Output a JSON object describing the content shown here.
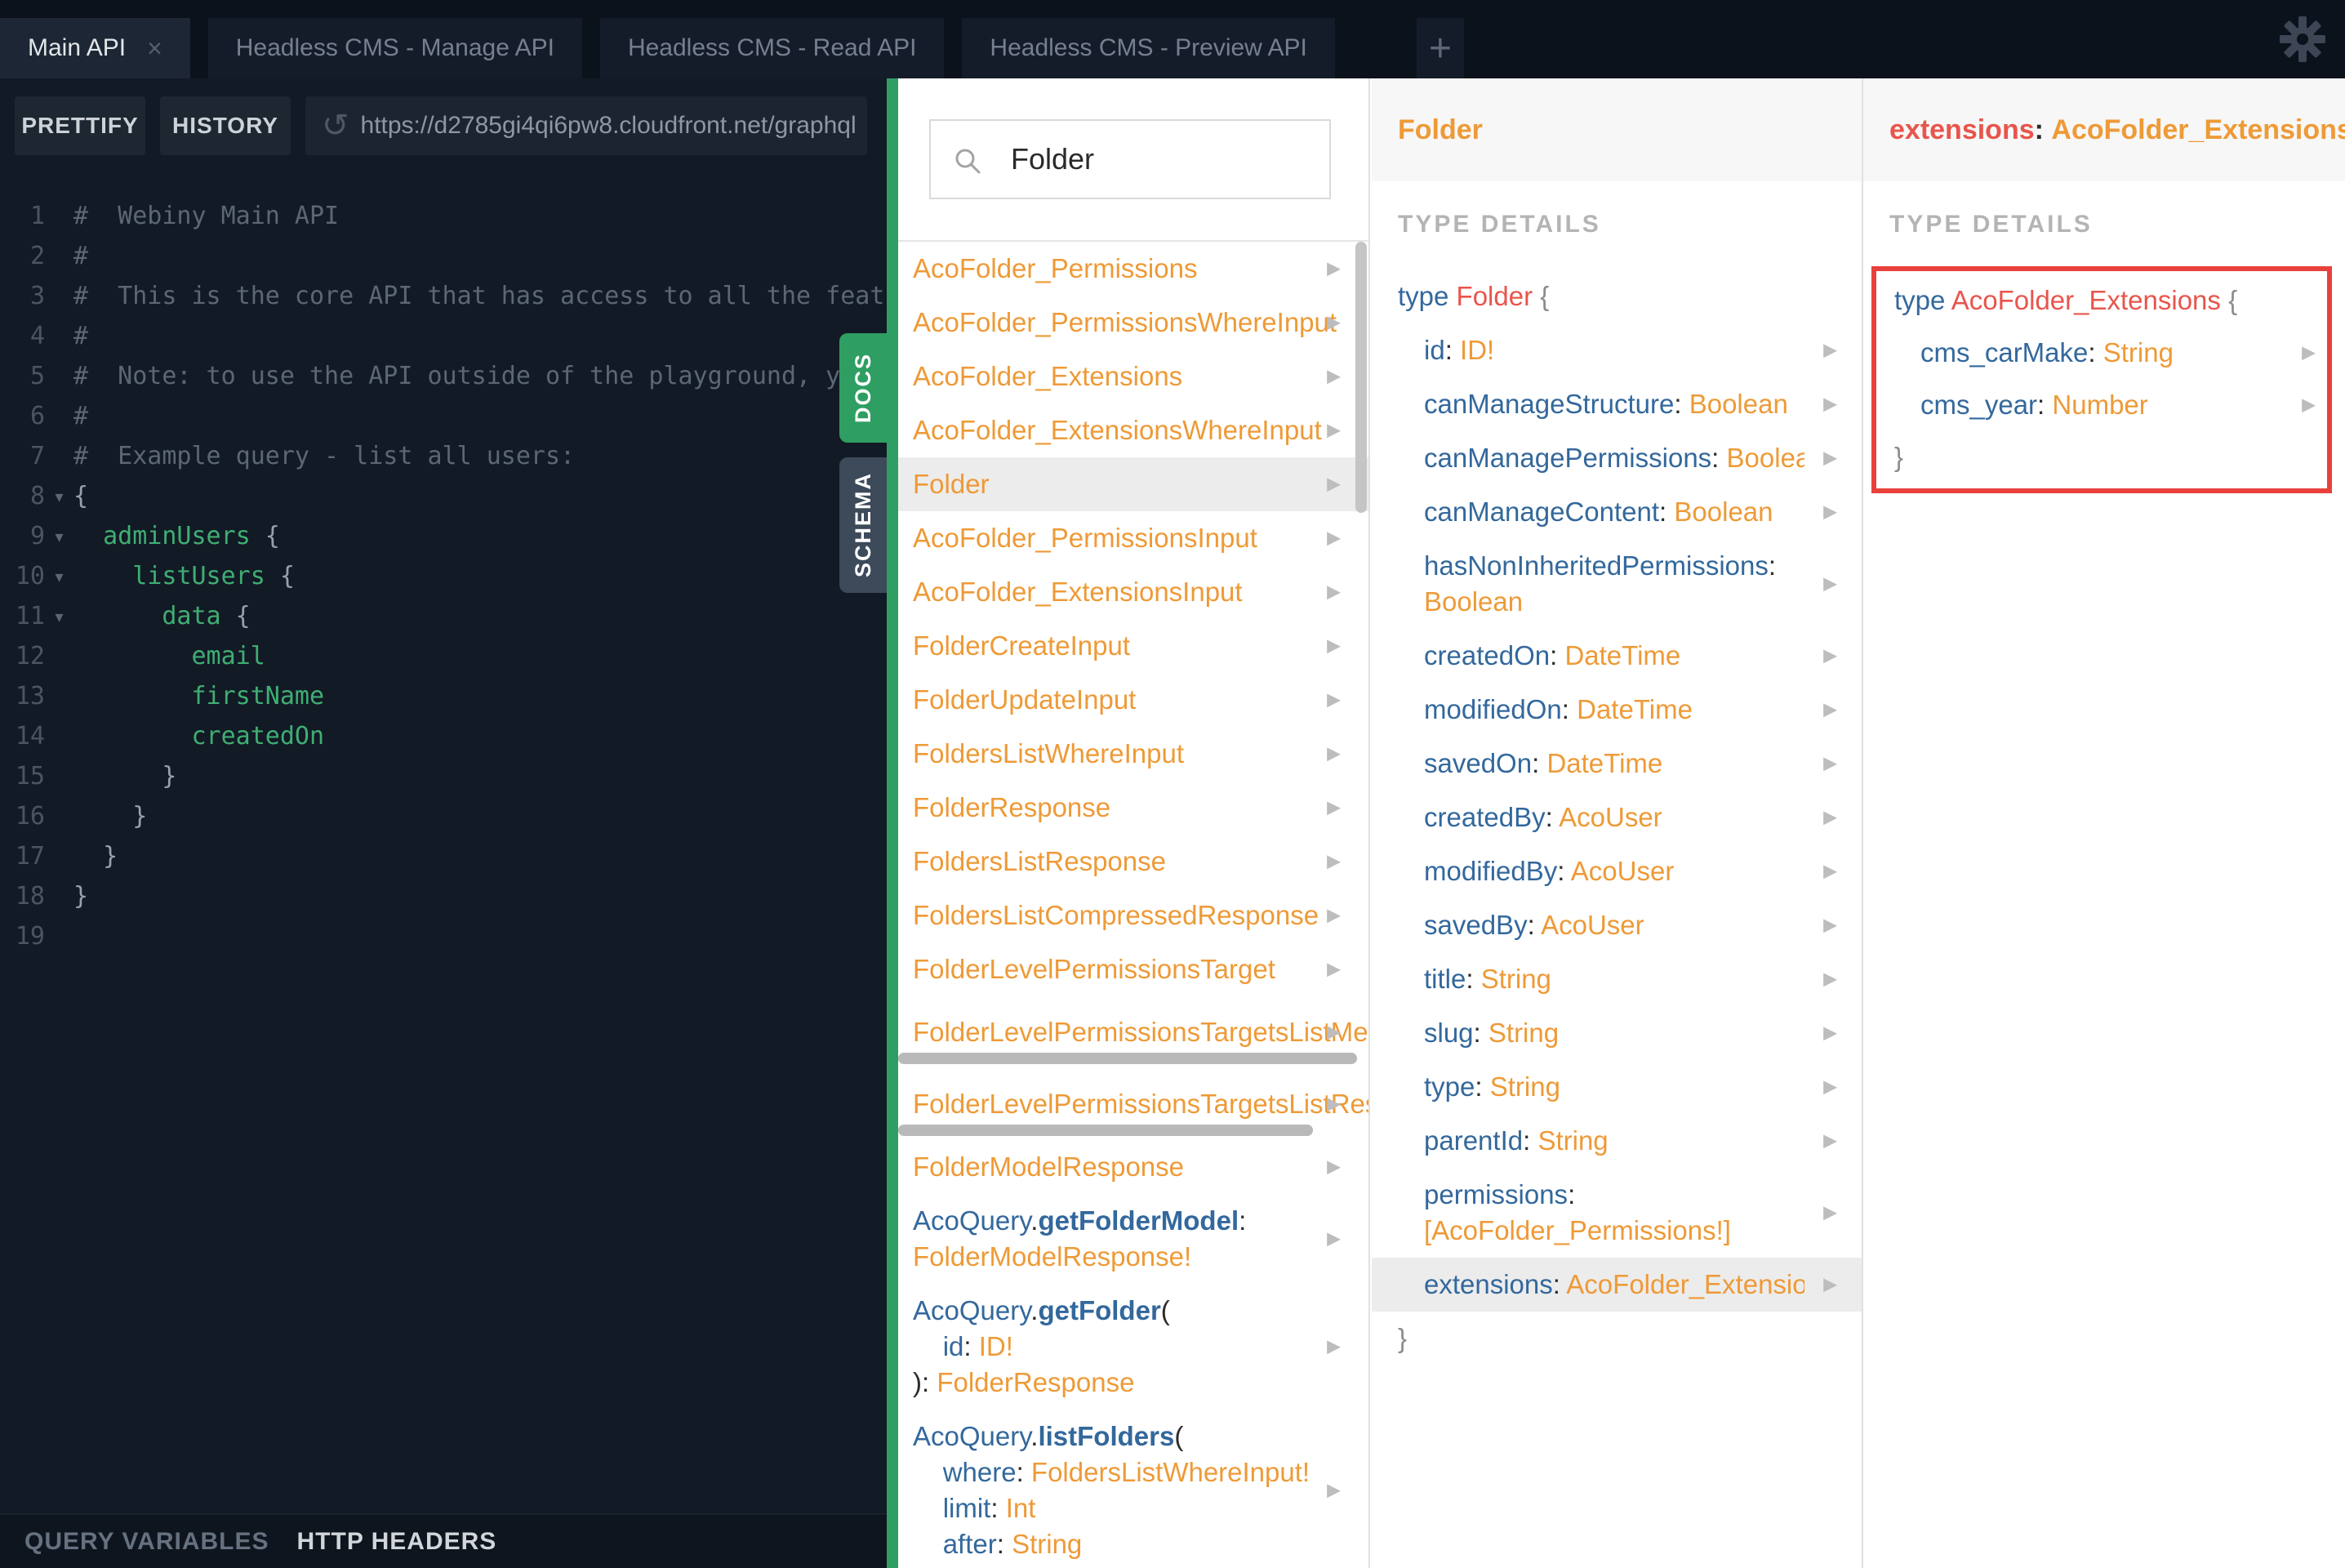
{
  "colors": {
    "accent_green": "#2f9e62",
    "type_orange": "#ee9a37",
    "field_blue": "#33689c",
    "selected_red": "#e8554c",
    "annotation_red": "#e8413c",
    "dark_bg": "#0c121c",
    "editor_bg": "#121a25"
  },
  "icons": {
    "close": "×",
    "plus": "+",
    "gear": "gear-icon",
    "search": "magnifier-icon",
    "reload": "↺",
    "row_arrow": "▶",
    "fold_arrow": "▾"
  },
  "tabs": {
    "items": [
      {
        "label": "Main API",
        "active": true,
        "closable": true
      },
      {
        "label": "Headless CMS - Manage API",
        "active": false,
        "closable": false
      },
      {
        "label": "Headless CMS - Read API",
        "active": false,
        "closable": false
      },
      {
        "label": "Headless CMS - Preview API",
        "active": false,
        "closable": false
      }
    ],
    "add_label": "+"
  },
  "toolbar": {
    "prettify": "PRETTIFY",
    "history": "HISTORY",
    "url": "https://d2785gi4qi6pw8.cloudfront.net/graphql"
  },
  "side_tabs": {
    "docs": "DOCS",
    "schema": "SCHEMA"
  },
  "bottom_bar": {
    "query_variables": "QUERY VARIABLES",
    "http_headers": "HTTP HEADERS"
  },
  "editor": {
    "lines": [
      {
        "num": 1,
        "fold": false,
        "segments": [
          {
            "c": "c",
            "v": "#  Webiny Main API"
          }
        ]
      },
      {
        "num": 2,
        "fold": false,
        "segments": [
          {
            "c": "c",
            "v": "#"
          }
        ]
      },
      {
        "num": 3,
        "fold": false,
        "segments": [
          {
            "c": "c",
            "v": "#  This is the core API that has access to all the features"
          }
        ]
      },
      {
        "num": 4,
        "fold": false,
        "segments": [
          {
            "c": "c",
            "v": "#"
          }
        ]
      },
      {
        "num": 5,
        "fold": false,
        "segments": [
          {
            "c": "c",
            "v": "#  Note: to use the API outside of the playground, you must"
          }
        ]
      },
      {
        "num": 6,
        "fold": false,
        "segments": [
          {
            "c": "c",
            "v": "#"
          }
        ]
      },
      {
        "num": 7,
        "fold": false,
        "segments": [
          {
            "c": "c",
            "v": "#  Example query - list all users:"
          }
        ]
      },
      {
        "num": 8,
        "fold": true,
        "segments": [
          {
            "c": "g",
            "v": "{"
          }
        ]
      },
      {
        "num": 9,
        "fold": true,
        "segments": [
          {
            "c": "pl",
            "v": "  "
          },
          {
            "c": "f",
            "v": "adminUsers"
          },
          {
            "c": "g",
            "v": " {"
          }
        ]
      },
      {
        "num": 10,
        "fold": true,
        "segments": [
          {
            "c": "pl",
            "v": "    "
          },
          {
            "c": "f",
            "v": "listUsers"
          },
          {
            "c": "g",
            "v": " {"
          }
        ]
      },
      {
        "num": 11,
        "fold": true,
        "segments": [
          {
            "c": "pl",
            "v": "      "
          },
          {
            "c": "f",
            "v": "data"
          },
          {
            "c": "g",
            "v": " {"
          }
        ]
      },
      {
        "num": 12,
        "fold": false,
        "segments": [
          {
            "c": "pl",
            "v": "        "
          },
          {
            "c": "f",
            "v": "email"
          }
        ]
      },
      {
        "num": 13,
        "fold": false,
        "segments": [
          {
            "c": "pl",
            "v": "        "
          },
          {
            "c": "f",
            "v": "firstName"
          }
        ]
      },
      {
        "num": 14,
        "fold": false,
        "segments": [
          {
            "c": "pl",
            "v": "        "
          },
          {
            "c": "f",
            "v": "createdOn"
          }
        ]
      },
      {
        "num": 15,
        "fold": false,
        "segments": [
          {
            "c": "g",
            "v": "      }"
          }
        ]
      },
      {
        "num": 16,
        "fold": false,
        "segments": [
          {
            "c": "g",
            "v": "    }"
          }
        ]
      },
      {
        "num": 17,
        "fold": false,
        "segments": [
          {
            "c": "g",
            "v": "  }"
          }
        ]
      },
      {
        "num": 18,
        "fold": false,
        "segments": [
          {
            "c": "g",
            "v": "}"
          }
        ]
      },
      {
        "num": 19,
        "fold": false,
        "segments": []
      }
    ]
  },
  "docs": {
    "search_value": "Folder",
    "items": [
      {
        "lines": [
          [
            {
              "c": "o",
              "v": "AcoFolder_Permissions"
            }
          ]
        ],
        "arrow": true
      },
      {
        "lines": [
          [
            {
              "c": "o",
              "v": "AcoFolder_PermissionsWhereInput"
            }
          ]
        ],
        "arrow": true
      },
      {
        "lines": [
          [
            {
              "c": "o",
              "v": "AcoFolder_Extensions"
            }
          ]
        ],
        "arrow": true
      },
      {
        "lines": [
          [
            {
              "c": "o",
              "v": "AcoFolder_ExtensionsWhereInput"
            }
          ]
        ],
        "arrow": true
      },
      {
        "lines": [
          [
            {
              "c": "o",
              "v": "Folder"
            }
          ]
        ],
        "arrow": true,
        "highlight": true
      },
      {
        "lines": [
          [
            {
              "c": "o",
              "v": "AcoFolder_PermissionsInput"
            }
          ]
        ],
        "arrow": true
      },
      {
        "lines": [
          [
            {
              "c": "o",
              "v": "AcoFolder_ExtensionsInput"
            }
          ]
        ],
        "arrow": true
      },
      {
        "lines": [
          [
            {
              "c": "o",
              "v": "FolderCreateInput"
            }
          ]
        ],
        "arrow": true
      },
      {
        "lines": [
          [
            {
              "c": "o",
              "v": "FolderUpdateInput"
            }
          ]
        ],
        "arrow": true
      },
      {
        "lines": [
          [
            {
              "c": "o",
              "v": "FoldersListWhereInput"
            }
          ]
        ],
        "arrow": true
      },
      {
        "lines": [
          [
            {
              "c": "o",
              "v": "FolderResponse"
            }
          ]
        ],
        "arrow": true
      },
      {
        "lines": [
          [
            {
              "c": "o",
              "v": "FoldersListResponse"
            }
          ]
        ],
        "arrow": true
      },
      {
        "lines": [
          [
            {
              "c": "o",
              "v": "FoldersListCompressedResponse"
            }
          ]
        ],
        "arrow": true
      },
      {
        "lines": [
          [
            {
              "c": "o",
              "v": "FolderLevelPermissionsTarget"
            }
          ]
        ],
        "arrow": true
      },
      {
        "lines": [
          [
            {
              "c": "o",
              "v": "FolderLevelPermissionsTargetsListMeta"
            }
          ]
        ],
        "arrow": true,
        "hbar_width": 562
      },
      {
        "lines": [
          [
            {
              "c": "o",
              "v": "FolderLevelPermissionsTargetsListResponse"
            }
          ]
        ],
        "arrow": true,
        "hbar_width": 508
      },
      {
        "lines": [
          [
            {
              "c": "o",
              "v": "FolderModelResponse"
            }
          ]
        ],
        "arrow": true
      },
      {
        "lines": [
          [
            {
              "c": "b",
              "v": "AcoQuery"
            },
            {
              "c": "p",
              "v": "."
            },
            {
              "c": "bb",
              "v": "getFolderModel"
            },
            {
              "c": "p",
              "v": ":"
            }
          ],
          [
            {
              "c": "o",
              "v": "FolderModelResponse!"
            }
          ]
        ],
        "arrow": true
      },
      {
        "lines": [
          [
            {
              "c": "b",
              "v": "AcoQuery"
            },
            {
              "c": "p",
              "v": "."
            },
            {
              "c": "bb",
              "v": "getFolder"
            },
            {
              "c": "p",
              "v": "("
            }
          ],
          [
            {
              "c": "pl",
              "v": "    "
            },
            {
              "c": "b",
              "v": "id"
            },
            {
              "c": "p",
              "v": ": "
            },
            {
              "c": "o",
              "v": "ID!"
            }
          ],
          [
            {
              "c": "p",
              "v": "): "
            },
            {
              "c": "o",
              "v": "FolderResponse"
            }
          ]
        ],
        "arrow": true
      },
      {
        "lines": [
          [
            {
              "c": "b",
              "v": "AcoQuery"
            },
            {
              "c": "p",
              "v": "."
            },
            {
              "c": "bb",
              "v": "listFolders"
            },
            {
              "c": "p",
              "v": "("
            }
          ],
          [
            {
              "c": "pl",
              "v": "    "
            },
            {
              "c": "b",
              "v": "where"
            },
            {
              "c": "p",
              "v": ": "
            },
            {
              "c": "o",
              "v": "FoldersListWhereInput!"
            }
          ],
          [
            {
              "c": "pl",
              "v": "    "
            },
            {
              "c": "b",
              "v": "limit"
            },
            {
              "c": "p",
              "v": ": "
            },
            {
              "c": "o",
              "v": "Int"
            }
          ],
          [
            {
              "c": "pl",
              "v": "    "
            },
            {
              "c": "b",
              "v": "after"
            },
            {
              "c": "p",
              "v": ": "
            },
            {
              "c": "o",
              "v": "String"
            }
          ]
        ],
        "arrow": true
      }
    ]
  },
  "folder_panel": {
    "header_segments": [
      {
        "c": "o",
        "v": "Folder"
      }
    ],
    "section": "TYPE DETAILS",
    "rows": [
      {
        "decl": true,
        "lines": [
          [
            {
              "c": "b",
              "v": "type"
            },
            {
              "c": "pl",
              "v": " "
            },
            {
              "c": "r",
              "v": "Folder"
            },
            {
              "c": "pl",
              "v": " "
            },
            {
              "c": "g",
              "v": "{"
            }
          ]
        ]
      },
      {
        "arrow": true,
        "lines": [
          [
            {
              "c": "b",
              "v": "id"
            },
            {
              "c": "p",
              "v": ": "
            },
            {
              "c": "o",
              "v": "ID!"
            }
          ]
        ]
      },
      {
        "arrow": true,
        "lines": [
          [
            {
              "c": "b",
              "v": "canManageStructure"
            },
            {
              "c": "p",
              "v": ": "
            },
            {
              "c": "o",
              "v": "Boolean"
            }
          ]
        ]
      },
      {
        "arrow": true,
        "lines": [
          [
            {
              "c": "b",
              "v": "canManagePermissions"
            },
            {
              "c": "p",
              "v": ": "
            },
            {
              "c": "o",
              "v": "Boolean"
            }
          ]
        ]
      },
      {
        "arrow": true,
        "lines": [
          [
            {
              "c": "b",
              "v": "canManageContent"
            },
            {
              "c": "p",
              "v": ": "
            },
            {
              "c": "o",
              "v": "Boolean"
            }
          ]
        ]
      },
      {
        "arrow": true,
        "lines": [
          [
            {
              "c": "b",
              "v": "hasNonInheritedPermissions"
            },
            {
              "c": "p",
              "v": ":"
            }
          ],
          [
            {
              "c": "o",
              "v": "Boolean"
            }
          ]
        ]
      },
      {
        "arrow": true,
        "lines": [
          [
            {
              "c": "b",
              "v": "createdOn"
            },
            {
              "c": "p",
              "v": ": "
            },
            {
              "c": "o",
              "v": "DateTime"
            }
          ]
        ]
      },
      {
        "arrow": true,
        "lines": [
          [
            {
              "c": "b",
              "v": "modifiedOn"
            },
            {
              "c": "p",
              "v": ": "
            },
            {
              "c": "o",
              "v": "DateTime"
            }
          ]
        ]
      },
      {
        "arrow": true,
        "lines": [
          [
            {
              "c": "b",
              "v": "savedOn"
            },
            {
              "c": "p",
              "v": ": "
            },
            {
              "c": "o",
              "v": "DateTime"
            }
          ]
        ]
      },
      {
        "arrow": true,
        "lines": [
          [
            {
              "c": "b",
              "v": "createdBy"
            },
            {
              "c": "p",
              "v": ": "
            },
            {
              "c": "o",
              "v": "AcoUser"
            }
          ]
        ]
      },
      {
        "arrow": true,
        "lines": [
          [
            {
              "c": "b",
              "v": "modifiedBy"
            },
            {
              "c": "p",
              "v": ": "
            },
            {
              "c": "o",
              "v": "AcoUser"
            }
          ]
        ]
      },
      {
        "arrow": true,
        "lines": [
          [
            {
              "c": "b",
              "v": "savedBy"
            },
            {
              "c": "p",
              "v": ": "
            },
            {
              "c": "o",
              "v": "AcoUser"
            }
          ]
        ]
      },
      {
        "arrow": true,
        "lines": [
          [
            {
              "c": "b",
              "v": "title"
            },
            {
              "c": "p",
              "v": ": "
            },
            {
              "c": "o",
              "v": "String"
            }
          ]
        ]
      },
      {
        "arrow": true,
        "lines": [
          [
            {
              "c": "b",
              "v": "slug"
            },
            {
              "c": "p",
              "v": ": "
            },
            {
              "c": "o",
              "v": "String"
            }
          ]
        ]
      },
      {
        "arrow": true,
        "lines": [
          [
            {
              "c": "b",
              "v": "type"
            },
            {
              "c": "p",
              "v": ": "
            },
            {
              "c": "o",
              "v": "String"
            }
          ]
        ]
      },
      {
        "arrow": true,
        "lines": [
          [
            {
              "c": "b",
              "v": "parentId"
            },
            {
              "c": "p",
              "v": ": "
            },
            {
              "c": "o",
              "v": "String"
            }
          ]
        ]
      },
      {
        "arrow": true,
        "lines": [
          [
            {
              "c": "b",
              "v": "permissions"
            },
            {
              "c": "p",
              "v": ":"
            }
          ],
          [
            {
              "c": "o",
              "v": "[AcoFolder_Permissions!]"
            }
          ]
        ]
      },
      {
        "arrow": true,
        "highlight": true,
        "lines": [
          [
            {
              "c": "b",
              "v": "extensions"
            },
            {
              "c": "p",
              "v": ": "
            },
            {
              "c": "o",
              "v": "AcoFolder_Extensions"
            }
          ]
        ]
      },
      {
        "decl": true,
        "lines": [
          [
            {
              "c": "g",
              "v": "}"
            }
          ]
        ]
      }
    ]
  },
  "extensions_panel": {
    "header_segments": [
      {
        "c": "r",
        "v": "extensions"
      },
      {
        "c": "p",
        "v": ": "
      },
      {
        "c": "o",
        "v": "AcoFolder_Extensions"
      }
    ],
    "section": "TYPE DETAILS",
    "rows": [
      {
        "decl": true,
        "lines": [
          [
            {
              "c": "b",
              "v": "type"
            },
            {
              "c": "pl",
              "v": " "
            },
            {
              "c": "r",
              "v": "AcoFolder_Extensions"
            },
            {
              "c": "pl",
              "v": " "
            },
            {
              "c": "g",
              "v": "{"
            }
          ]
        ]
      },
      {
        "arrow": true,
        "field": true,
        "lines": [
          [
            {
              "c": "b",
              "v": "cms_carMake"
            },
            {
              "c": "p",
              "v": ": "
            },
            {
              "c": "o",
              "v": "String"
            }
          ]
        ]
      },
      {
        "arrow": true,
        "field": true,
        "lines": [
          [
            {
              "c": "b",
              "v": "cms_year"
            },
            {
              "c": "p",
              "v": ": "
            },
            {
              "c": "o",
              "v": "Number"
            }
          ]
        ]
      },
      {
        "decl": true,
        "lines": [
          [
            {
              "c": "g",
              "v": "}"
            }
          ]
        ]
      }
    ]
  }
}
